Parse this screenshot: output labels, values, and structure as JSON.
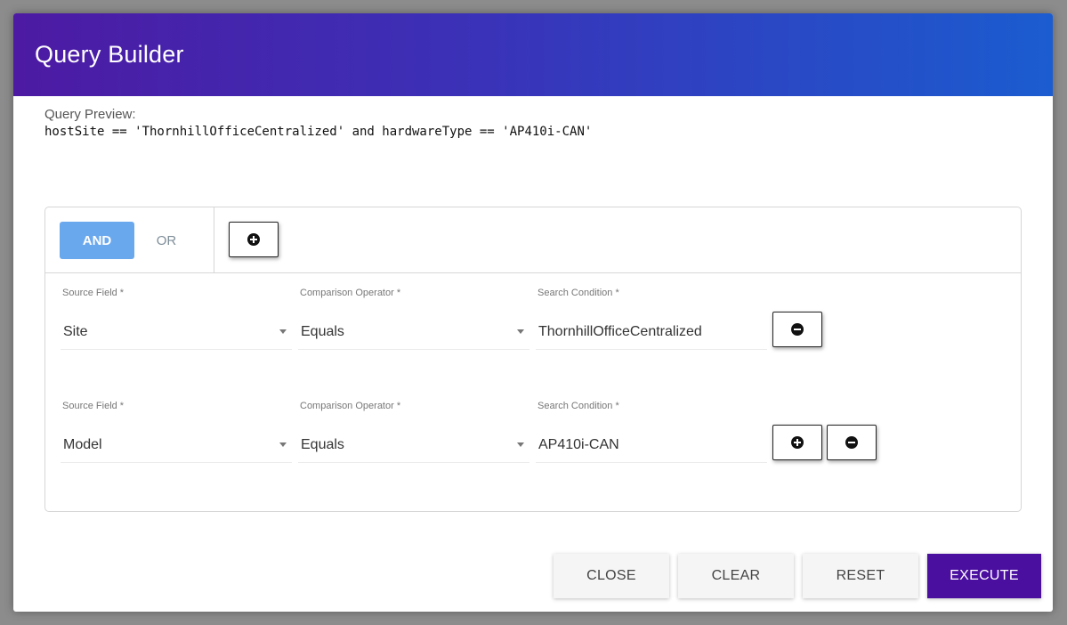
{
  "dialog": {
    "title": "Query Builder"
  },
  "preview": {
    "label": "Query Preview:",
    "query": "hostSite == 'ThornhillOfficeCentralized' and hardwareType == 'AP410i-CAN'"
  },
  "logic": {
    "and_label": "AND",
    "or_label": "OR",
    "selected": "AND"
  },
  "rows": [
    {
      "source_label": "Source Field *",
      "source_value": "Site",
      "operator_label": "Comparison Operator *",
      "operator_value": "Equals",
      "condition_label": "Search Condition *",
      "condition_value": "ThornhillOfficeCentralized"
    },
    {
      "source_label": "Source Field *",
      "source_value": "Model",
      "operator_label": "Comparison Operator *",
      "operator_value": "Equals",
      "condition_label": "Search Condition *",
      "condition_value": "AP410i-CAN"
    }
  ],
  "footer": {
    "close_label": "CLOSE",
    "clear_label": "CLEAR",
    "reset_label": "RESET",
    "execute_label": "EXECUTE"
  },
  "colors": {
    "header_gradient_start": "#4d1aa3",
    "header_gradient_end": "#1b5cd0",
    "and_active": "#6aa8ee",
    "execute_bg": "#4b0fa0"
  },
  "icons": {
    "add": "plus-circle-icon",
    "remove": "minus-circle-icon",
    "dropdown": "caret-down-icon"
  }
}
